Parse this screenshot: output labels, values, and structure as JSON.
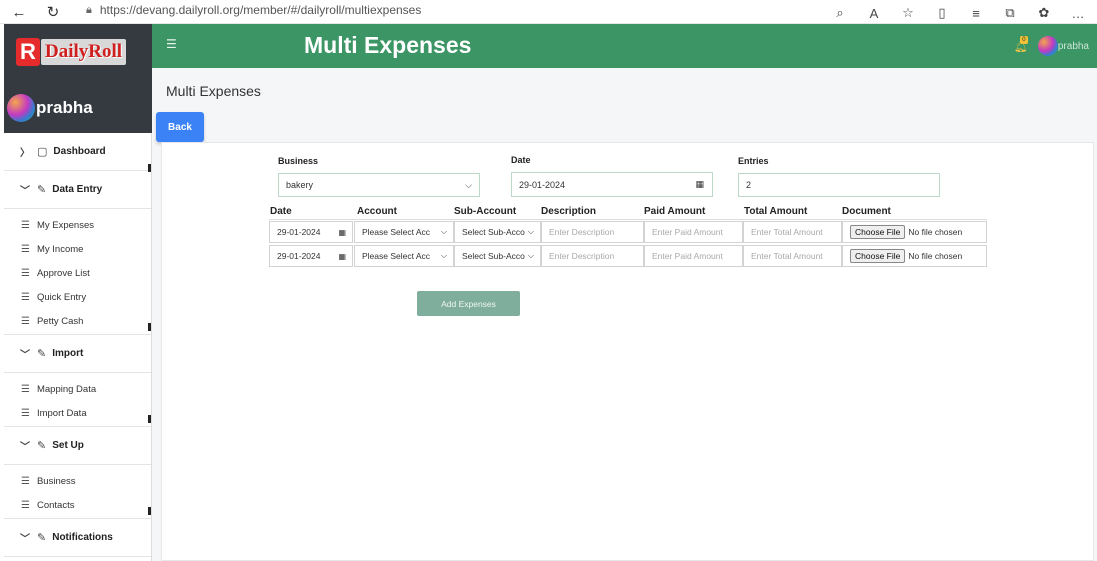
{
  "browser": {
    "url": "https://devang.dailyroll.org/member/#/dailyroll/multiexpenses"
  },
  "sidebar": {
    "logo_letter": "R",
    "logo_name": "DailyRoll",
    "user_name": "prabha",
    "sections": [
      {
        "label": "Dashboard",
        "items": []
      },
      {
        "label": "Data Entry",
        "items": [
          "My Expenses",
          "My Income",
          "Approve List",
          "Quick Entry",
          "Petty Cash"
        ]
      },
      {
        "label": "Import",
        "items": [
          "Mapping Data",
          "Import Data"
        ]
      },
      {
        "label": "Set Up",
        "items": [
          "Business",
          "Contacts"
        ]
      },
      {
        "label": "Notifications",
        "items": []
      }
    ]
  },
  "topbar": {
    "title": "Multi Expenses",
    "user_name": "prabha",
    "notification_count": "0"
  },
  "main": {
    "heading": "Multi Expenses",
    "back_label": "Back",
    "business_label": "Business",
    "business_value": "bakery",
    "date_label": "Date",
    "date_value": "29-01-2024",
    "entries_label": "Entries",
    "entries_value": "2",
    "columns": [
      "Date",
      "Account",
      "Sub-Account",
      "Description",
      "Paid Amount",
      "Total Amount",
      "Document"
    ],
    "rows": [
      {
        "date": "29-01-2024",
        "account": "Please Select Acc",
        "sub_account": "Select Sub-Acco",
        "description": "Enter Description",
        "paid": "Enter Paid Amount",
        "total": "Enter Total Amount",
        "file_btn": "Choose File",
        "file_status": "No file chosen"
      },
      {
        "date": "29-01-2024",
        "account": "Please Select Acc",
        "sub_account": "Select Sub-Acco",
        "description": "Enter Description",
        "paid": "Enter Paid Amount",
        "total": "Enter Total Amount",
        "file_btn": "Choose File",
        "file_status": "No file chosen"
      }
    ],
    "add_label": "Add Expenses"
  },
  "colors": {
    "topbar": "#3b9565",
    "sidebar_header": "#343a40",
    "back_button": "#3b82f6",
    "add_button": "#7fae9c"
  }
}
